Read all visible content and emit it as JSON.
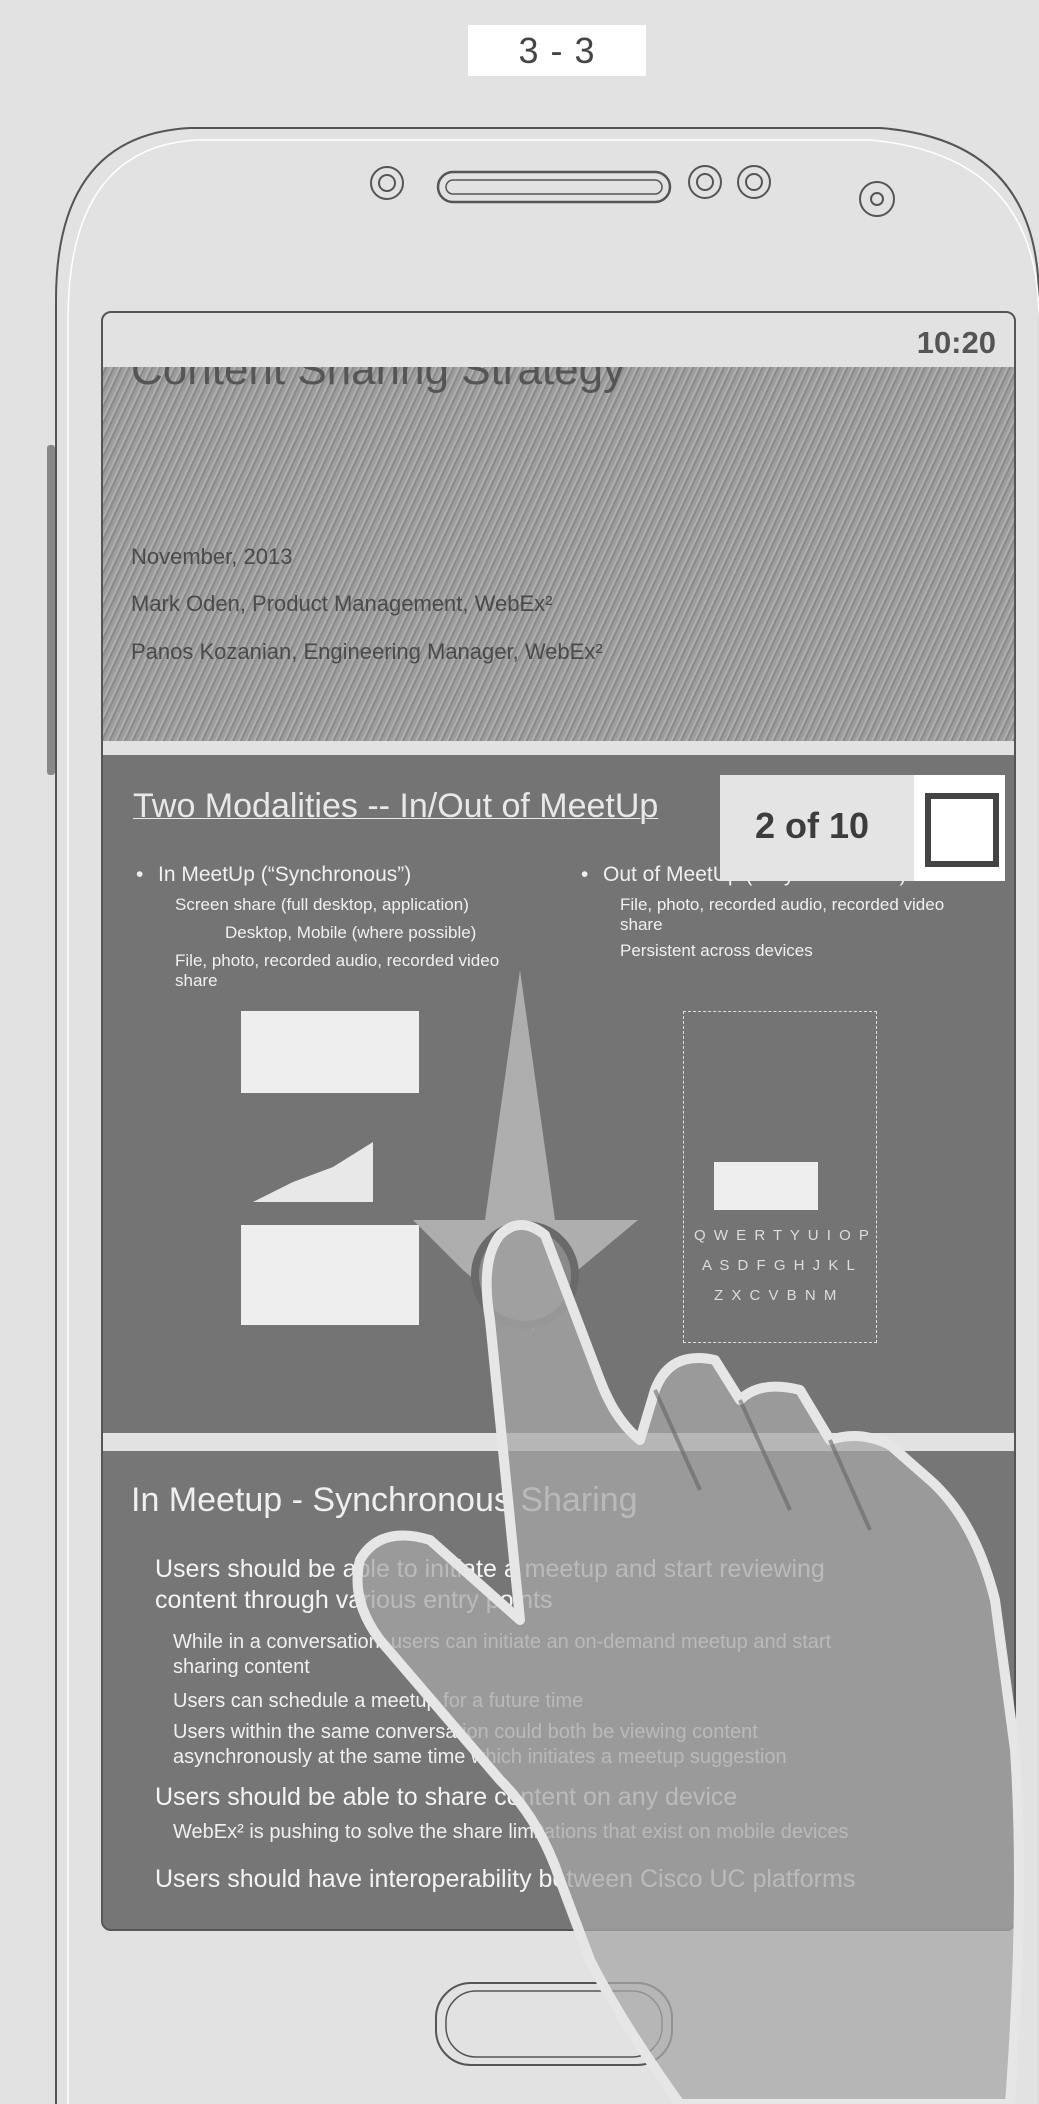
{
  "page_label": "3 - 3",
  "status": {
    "time": "10:20"
  },
  "slide1": {
    "title": "Content Sharing Strategy",
    "date": "November, 2013",
    "author1": "Mark Oden, Product Management, WebEx²",
    "author2": "Panos Kozanian, Engineering Manager, WebEx²"
  },
  "slide2": {
    "title": "Two Modalities -- In/Out of MeetUp",
    "counter": "2 of 10",
    "left_heading": "In MeetUp (“Synchronous”)",
    "left_items": [
      "Screen share (full desktop, application)",
      "Desktop, Mobile (where possible)",
      "File, photo, recorded audio, recorded video",
      "share"
    ],
    "right_heading": "Out of MeetUp (“Asynchronous”)",
    "right_items": [
      "File, photo, recorded audio, recorded video",
      "share",
      "Persistent across devices"
    ],
    "keyboard_rows": [
      "Q W E R T Y U I O P",
      "A S D F G H J K L",
      "Z X C V B N M"
    ]
  },
  "slide3": {
    "title": "In Meetup - Synchronous Sharing",
    "bullet1_line1": "Users should be able to initiate a meetup and start reviewing",
    "bullet1_line2": "content through various entry points",
    "sub1a_line1": "While in a conversation, users can initiate an on-demand meetup and start",
    "sub1a_line2": "sharing content",
    "sub1b": "Users can schedule a meetup for a future time",
    "sub1c_line1": "Users within the same conversation could both be viewing content",
    "sub1c_line2": "asynchronously at the same time which initiates a meetup suggestion",
    "bullet2": "Users should be able to share content on any device",
    "sub2a": "WebEx² is pushing to solve the share limitations that exist on mobile devices",
    "bullet3": "Users should have interoperability between Cisco UC platforms"
  },
  "colors": {
    "background": "#e2e2e2",
    "screen": "#767676",
    "outline": "#555555"
  },
  "icons": [
    "camera-icon",
    "speaker-grille-icon",
    "sensor-icon",
    "home-button-icon",
    "swipe-up-arrow-icon",
    "hand-gesture-icon",
    "checkbox-icon"
  ]
}
